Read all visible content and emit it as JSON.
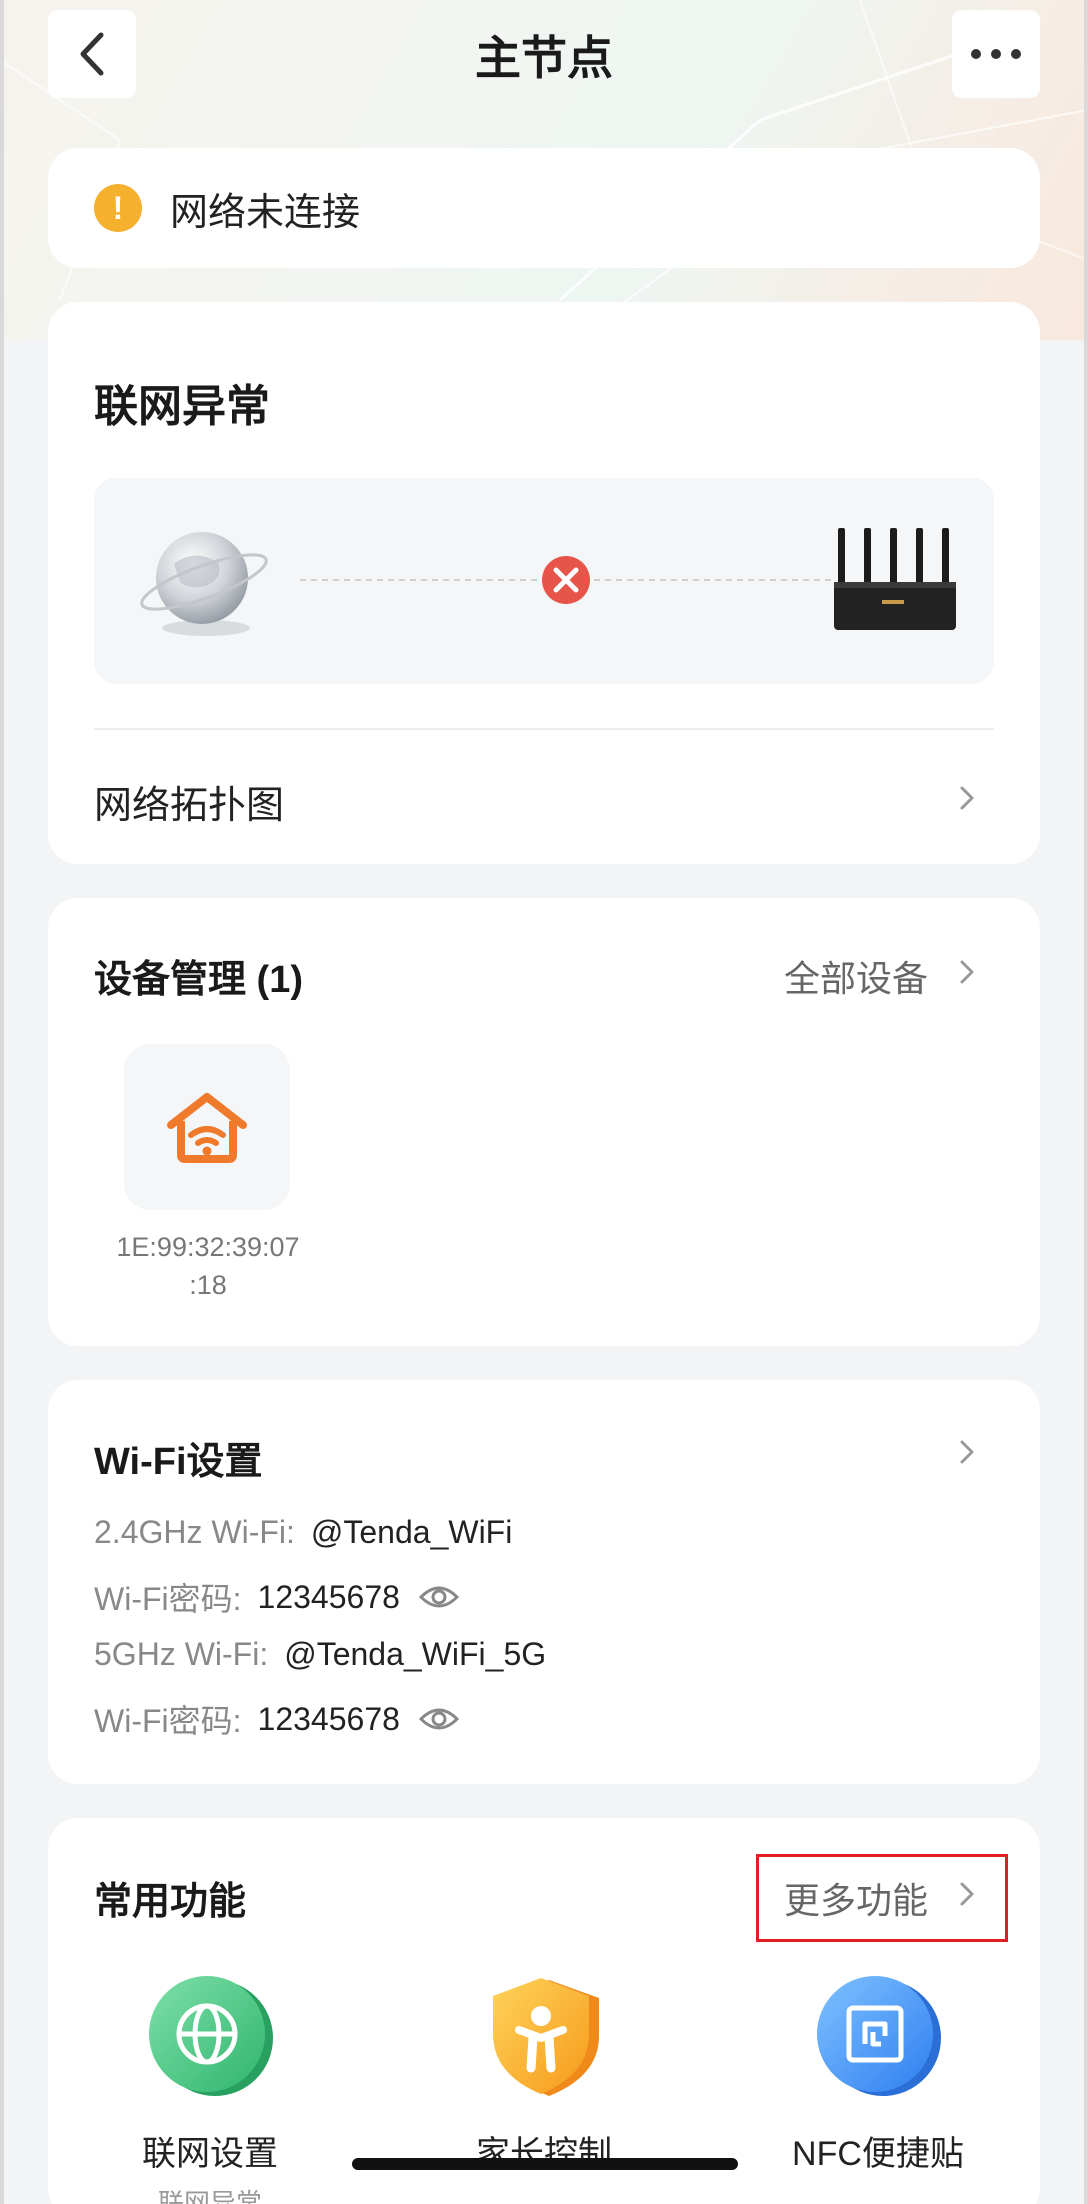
{
  "header": {
    "title": "主节点"
  },
  "status": {
    "text": "网络未连接"
  },
  "network": {
    "title": "联网异常",
    "topology_label": "网络拓扑图"
  },
  "devices": {
    "title": "设备管理 (1)",
    "all_label": "全部设备",
    "items": [
      {
        "mac_line1": "1E:99:32:39:07",
        "mac_line2": ":18"
      }
    ]
  },
  "wifi": {
    "title": "Wi-Fi设置",
    "rows": [
      {
        "label": "2.4GHz Wi-Fi:",
        "value": "@Tenda_WiFi"
      },
      {
        "label": "Wi-Fi密码:",
        "value": "12345678"
      },
      {
        "label": "5GHz Wi-Fi:",
        "value": "@Tenda_WiFi_5G"
      },
      {
        "label": "Wi-Fi密码:",
        "value": "12345678"
      }
    ]
  },
  "functions": {
    "title": "常用功能",
    "more_label": "更多功能",
    "items": [
      {
        "label": "联网设置",
        "sub": "联网异常"
      },
      {
        "label": "家长控制",
        "sub": ""
      },
      {
        "label": "NFC便捷贴",
        "sub": ""
      }
    ]
  },
  "colors": {
    "accent_orange": "#f07a2c",
    "warning": "#f5b02e",
    "error": "#e6544a",
    "highlight_box": "#e01e24"
  }
}
